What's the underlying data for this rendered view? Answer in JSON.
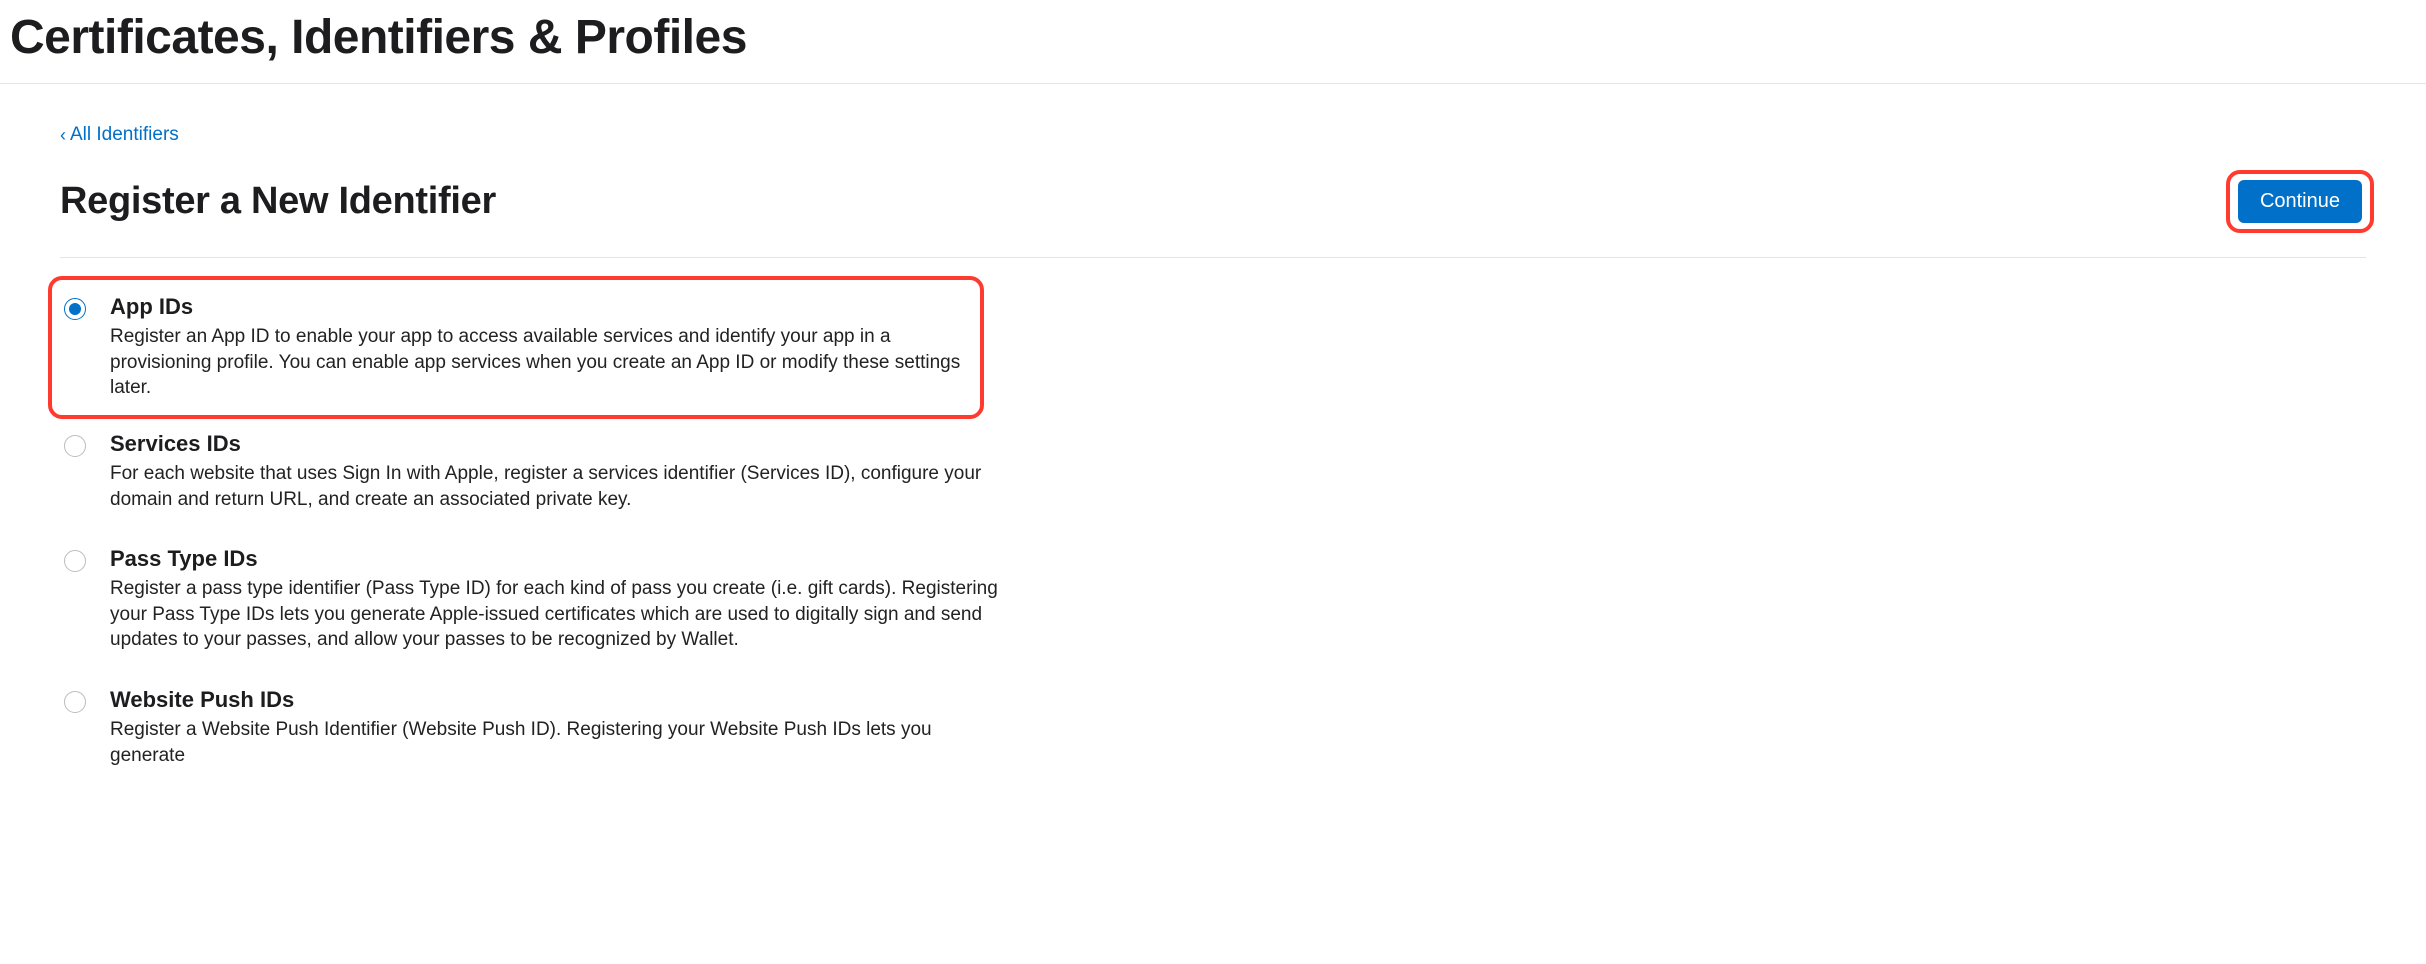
{
  "header": {
    "page_title": "Certificates, Identifiers & Profiles",
    "back_link": "All Identifiers",
    "subtitle": "Register a New Identifier",
    "continue_label": "Continue"
  },
  "options": [
    {
      "title": "App IDs",
      "desc": "Register an App ID to enable your app to access available services and identify your app in a provisioning profile. You can enable app services when you create an App ID or modify these settings later.",
      "selected": true,
      "highlighted": true
    },
    {
      "title": "Services IDs",
      "desc": "For each website that uses Sign In with Apple, register a services identifier (Services ID), configure your domain and return URL, and create an associated private key.",
      "selected": false,
      "highlighted": false
    },
    {
      "title": "Pass Type IDs",
      "desc": "Register a pass type identifier (Pass Type ID) for each kind of pass you create (i.e. gift cards). Registering your Pass Type IDs lets you generate Apple-issued certificates which are used to digitally sign and send updates to your passes, and allow your passes to be recognized by Wallet.",
      "selected": false,
      "highlighted": false
    },
    {
      "title": "Website Push IDs",
      "desc": "Register a Website Push Identifier (Website Push ID). Registering your Website Push IDs lets you generate",
      "selected": false,
      "highlighted": false
    }
  ],
  "annotations": {
    "continue_highlighted": true
  }
}
